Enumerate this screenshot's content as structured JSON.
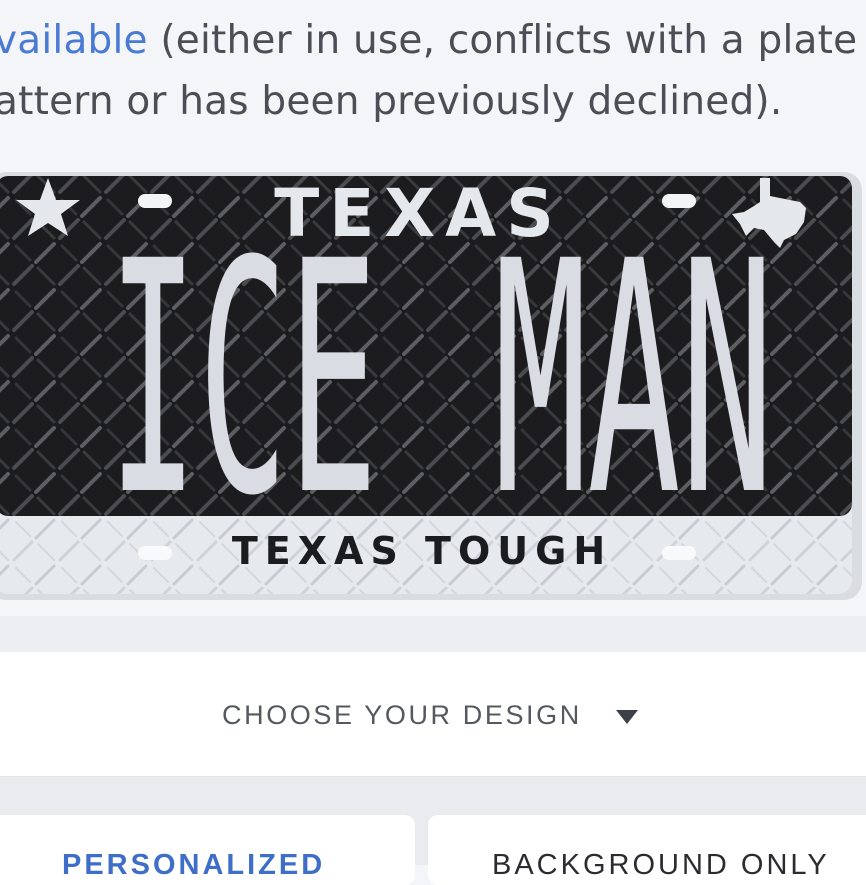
{
  "notice": {
    "line1_link": "vailable",
    "line1_rest": " (either in use, conflicts with a plate",
    "line2": "attern or has been previously declined)."
  },
  "plate": {
    "state": "TEXAS",
    "text_left": "ICE",
    "text_right": "MAN",
    "slogan": "TEXAS TOUGH",
    "colors": {
      "background": "#1c1c1e",
      "lettering": "#d9dde3",
      "frame": "#dfe3e8"
    }
  },
  "design": {
    "label": "CHOOSE YOUR DESIGN",
    "icon": "caret-down-icon"
  },
  "options": {
    "personalized": "PERSONALIZED",
    "background_only": "BACKGROUND ONLY"
  },
  "colors": {
    "link": "#4a7bd4",
    "active_tab": "#3f6ec9",
    "text": "#4b4f55"
  }
}
